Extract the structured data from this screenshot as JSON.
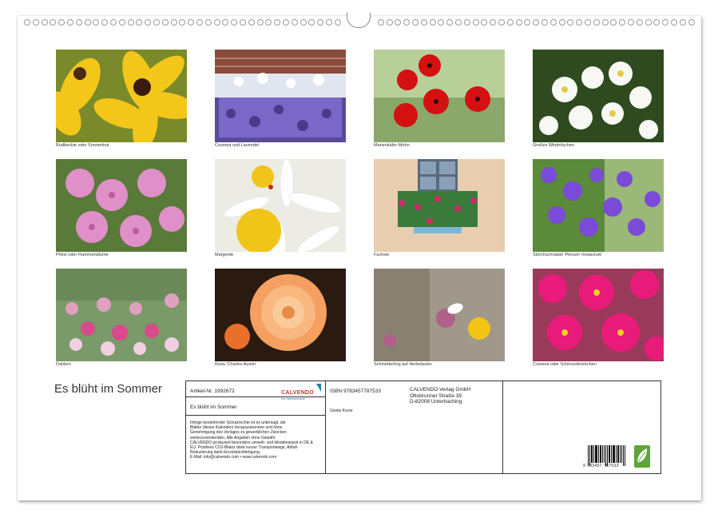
{
  "photos": [
    {
      "id": "rudbeckie",
      "caption": "Rudbeckie oder Sonnenhut"
    },
    {
      "id": "cosmea-lavendel",
      "caption": "Cosmea und Lavendel"
    },
    {
      "id": "mohn",
      "caption": "Marienkäfer-Mohn"
    },
    {
      "id": "windroeschen",
      "caption": "Großes Windröschen"
    },
    {
      "id": "phlox",
      "caption": "Phlox oder Flammenblume"
    },
    {
      "id": "margerite",
      "caption": "Margerite"
    },
    {
      "id": "fuchsie",
      "caption": "Fuchsie"
    },
    {
      "id": "storchschnabel",
      "caption": "Storchschnabel 'Plenum Violaceum'"
    },
    {
      "id": "dahlien",
      "caption": "Dahlien"
    },
    {
      "id": "rosa",
      "caption": "Rosa 'Charles Austin'"
    },
    {
      "id": "schmetterling",
      "caption": "Schmetterling auf Herbstaster"
    },
    {
      "id": "cosmea",
      "caption": "Cosmea oder Schmuckkörbchen"
    }
  ],
  "calendar_title": "Es blüht im Sommer",
  "info": {
    "article": "Artikel-Nr. 1992672",
    "logo_word": "CALVENDO",
    "logo_sub": "Die Kalendermarke",
    "title": "Es blüht im Sommer",
    "legal_lines": [
      "Infolge bestehender Schutzrechte ist es untersagt, die",
      "Blätter dieses Kalenders herauszutrennen und ohne",
      "Genehmigung des Verlages zu gewerblichen Zwecken",
      "weiterzuverwenden. Alle Angaben ohne Gewähr.",
      "CALVENDO produziert besonders umwelt- und klimabewusst in DE &",
      "EU. Positives CO2-Bilanz dank kurzer Transportwege, Abfall-",
      "Reduzierung dank Einzelstückfertigung.",
      "E-Mail: info@calvendo.com • www.calvendo.com"
    ],
    "isbn": "ISBN 9783457787533",
    "author": "Gisela Kruse",
    "publisher_lines": [
      "CALVENDO Verlag GmbH",
      "Ottobrunner Straße 39",
      "D-82008 Unterhaching"
    ],
    "barcode_number": "9 783457 787533"
  }
}
